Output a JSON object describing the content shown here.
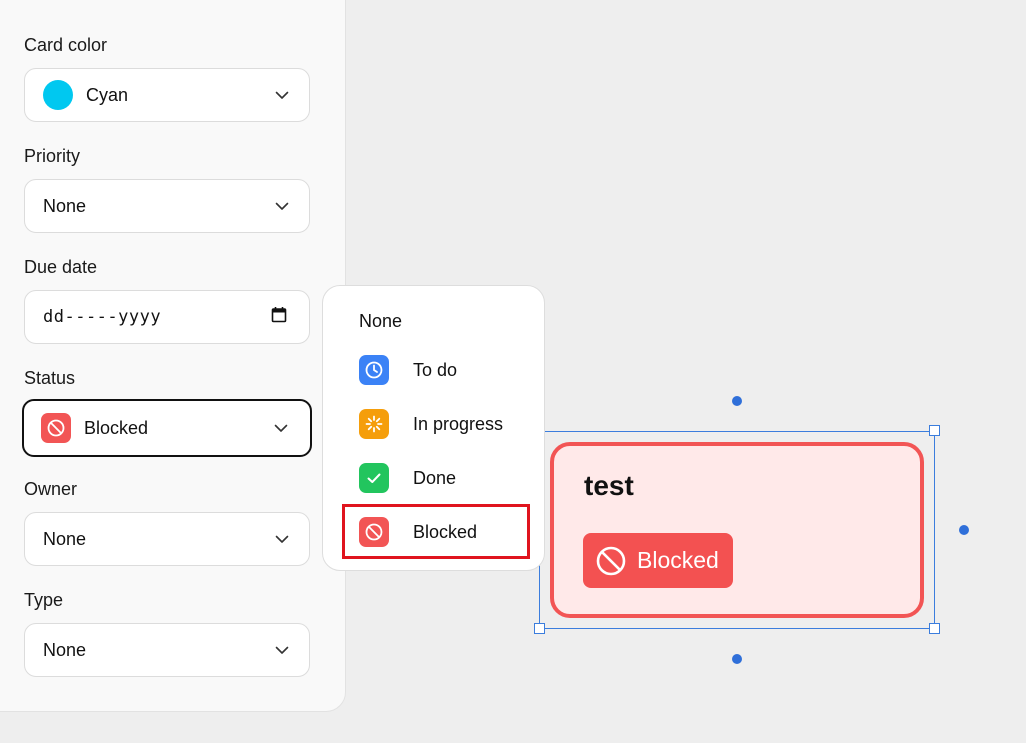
{
  "panel": {
    "card_color": {
      "label": "Card color",
      "value": "Cyan",
      "swatch": "#00c8f0"
    },
    "priority": {
      "label": "Priority",
      "value": "None"
    },
    "due_date": {
      "label": "Due date",
      "placeholder": "dd-----yyyy"
    },
    "status": {
      "label": "Status",
      "value": "Blocked",
      "icon": "blocked-icon",
      "color": "#f25555"
    },
    "owner": {
      "label": "Owner",
      "value": "None"
    },
    "type": {
      "label": "Type",
      "value": "None"
    }
  },
  "status_menu": {
    "items": [
      {
        "label": "None",
        "icon": ""
      },
      {
        "label": "To do",
        "icon": "clock-icon",
        "color": "#3b82f6"
      },
      {
        "label": "In progress",
        "icon": "spinner-icon",
        "color": "#f59e0b"
      },
      {
        "label": "Done",
        "icon": "check-icon",
        "color": "#22c55e"
      },
      {
        "label": "Blocked",
        "icon": "blocked-icon",
        "color": "#f25555"
      }
    ],
    "highlighted": "Blocked"
  },
  "card": {
    "title": "test",
    "badge_label": "Blocked",
    "background": "#ffe9e9",
    "border": "#f25555",
    "selection_color": "#3b7ddd"
  }
}
